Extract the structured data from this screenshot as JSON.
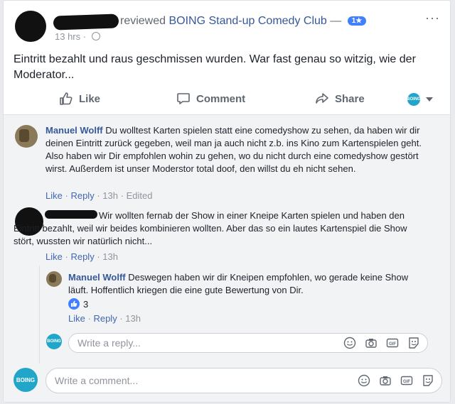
{
  "post": {
    "reviewed_text": "reviewed",
    "page_name": "BOING Stand-up Comedy Club",
    "rating_dash": "—",
    "rating": "1★",
    "time": "13 hrs",
    "time_sep": "·",
    "more": "···",
    "text": "Eintritt bezahlt und raus geschmissen wurden. War fast genau so witzig, wie der Moderator..."
  },
  "actions": {
    "like": "Like",
    "comment": "Comment",
    "share": "Share",
    "page_avatar_text": "BOING"
  },
  "comments": [
    {
      "author": "Manuel Wolff",
      "text": "Du wolltest Karten spielen statt eine comedyshow zu sehen, da haben wir dir deinen Eintritt zurück gegeben, weil man ja auch nicht z.b. ins Kino zum Kartenspielen geht. Also haben wir Dir empfohlen wohin zu gehen, wo du nicht durch eine comedyshow gestört wirst. Außerdem ist unser Moderstor total doof, den willst du eh nicht sehen.",
      "like": "Like",
      "reply": "Reply",
      "time": "13h",
      "edited": "Edited",
      "sep": "·"
    },
    {
      "author": "",
      "text": "Wir wollten fernab der Show in einer Kneipe Karten spielen und haben den Eintritt bezahlt, weil wir beides kombinieren wollten. Aber das so ein lautes Kartenspiel die Show stört, wussten wir natürlich nicht...",
      "like": "Like",
      "reply": "Reply",
      "time": "13h",
      "sep": "·"
    },
    {
      "author": "Manuel Wolff",
      "text": "Deswegen haben wir dir Kneipen empfohlen, wo gerade keine Show läuft. Hoffentlich kriegen die eine gute Bewertung von Dir.",
      "reactions": "3",
      "like": "Like",
      "reply": "Reply",
      "time": "13h",
      "sep": "·"
    }
  ],
  "reply_input": {
    "placeholder": "Write a reply...",
    "avatar_text": "BOING"
  },
  "comment_input": {
    "placeholder": "Write a comment...",
    "avatar_text": "BOING"
  },
  "input_icons": [
    "emoji-icon",
    "camera-icon",
    "gif-icon",
    "sticker-icon"
  ],
  "colors": {
    "link": "#365899",
    "action_link": "#4267b2",
    "muted": "#90949c",
    "brand": "#21a6c9",
    "like_blue": "#4080ff"
  }
}
